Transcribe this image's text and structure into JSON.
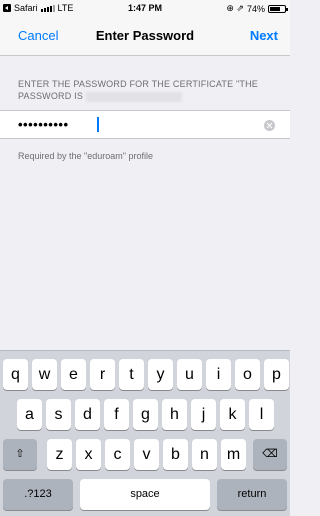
{
  "status_bar": {
    "back_app": "Safari",
    "network": "LTE",
    "time": "1:47 PM",
    "icons": "⊕ ⇗",
    "battery": "74%",
    "battery_level": 0.74
  },
  "nav": {
    "cancel": "Cancel",
    "title": "Enter Password",
    "next": "Next"
  },
  "prompt": {
    "line1": "ENTER THE PASSWORD FOR THE CERTIFICATE \"THE",
    "line2": "PASSWORD IS "
  },
  "password": {
    "masked_value": "••••••••••"
  },
  "footer_note": "Required by the \"eduroam\" profile",
  "keyboard": {
    "row1": [
      "q",
      "w",
      "e",
      "r",
      "t",
      "y",
      "u",
      "i",
      "o",
      "p"
    ],
    "row2": [
      "a",
      "s",
      "d",
      "f",
      "g",
      "h",
      "j",
      "k",
      "l"
    ],
    "row3": [
      "z",
      "x",
      "c",
      "v",
      "b",
      "n",
      "m"
    ],
    "shift": "⇧",
    "delete": "⌫",
    "numbers": ".?123",
    "space": "space",
    "return": "return"
  }
}
